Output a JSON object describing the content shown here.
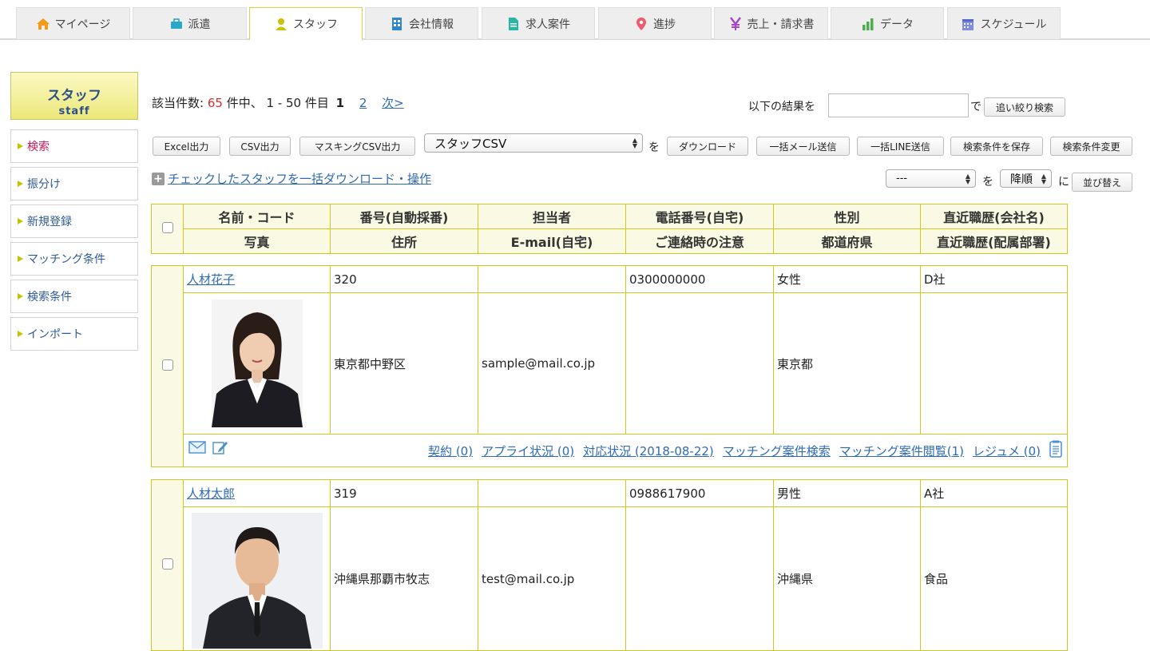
{
  "tabs": [
    {
      "label": "マイページ",
      "icon": "home-icon",
      "color": "#f29a1a"
    },
    {
      "label": "派遣",
      "icon": "briefcase-icon",
      "color": "#2aa7c9"
    },
    {
      "label": "スタッフ",
      "icon": "person-icon",
      "color": "#c9c200"
    },
    {
      "label": "会社情報",
      "icon": "building-icon",
      "color": "#2f87c9"
    },
    {
      "label": "求人案件",
      "icon": "document-icon",
      "color": "#27b5a8"
    },
    {
      "label": "進捗",
      "icon": "map-pin-icon",
      "color": "#ee5b6e"
    },
    {
      "label": "売上・請求書",
      "icon": "yen-icon",
      "color": "#a446c6"
    },
    {
      "label": "データ",
      "icon": "bar-chart-icon",
      "color": "#4cae4c"
    },
    {
      "label": "スケジュール",
      "icon": "calendar-icon",
      "color": "#7e8ee6"
    }
  ],
  "sidebar": {
    "title": "スタッフ",
    "subtitle": "staff",
    "items": [
      {
        "label": "検索"
      },
      {
        "label": "振分け"
      },
      {
        "label": "新規登録"
      },
      {
        "label": "マッチング条件"
      },
      {
        "label": "検索条件"
      },
      {
        "label": "インポート"
      }
    ]
  },
  "results": {
    "prefix": "該当件数:",
    "count": "65",
    "suffix": "件中、 1 - 50 件目",
    "current_page": "1",
    "page2": "2",
    "next": "次>"
  },
  "refine": {
    "label_before": "以下の結果を",
    "input_value": "",
    "label_after": "で",
    "button": "追い絞り検索"
  },
  "toolbar": {
    "excel": "Excel出力",
    "csv": "CSV出力",
    "masking_csv": "マスキングCSV出力",
    "csv_type_selected": "スタッフCSV",
    "wo": "を",
    "download": "ダウンロード",
    "bulk_mail": "一括メール送信",
    "bulk_line": "一括LINE送信",
    "save_search": "検索条件を保存",
    "change_search": "検索条件変更"
  },
  "bulk_link": "チェックしたスタッフを一括ダウンロード・操作",
  "sort": {
    "field_selected": "---",
    "wo": "を",
    "order_selected": "降順",
    "ni": "に",
    "button": "並び替え"
  },
  "header": {
    "row1": [
      "名前・コード",
      "番号(自動採番)",
      "担当者",
      "電話番号(自宅)",
      "性別",
      "直近職歴(会社名)"
    ],
    "row2": [
      "写真",
      "住所",
      "E-mail(自宅)",
      "ご連絡時の注意",
      "都道府県",
      "直近職歴(配属部署)"
    ]
  },
  "staff": [
    {
      "name": "人材花子",
      "number": "320",
      "manager": "",
      "phone": "0300000000",
      "gender": "女性",
      "company": "D社",
      "address": "東京都中野区",
      "email": "sample@mail.co.jp",
      "note": "",
      "prefecture": "東京都",
      "department": "",
      "links": [
        "契約 (0)",
        "アプライ状況 (0)",
        "対応状況 (2018-08-22)",
        "マッチング案件検索",
        "マッチング案件閲覧(1)",
        "レジュメ (0)"
      ]
    },
    {
      "name": "人材太郎",
      "number": "319",
      "manager": "",
      "phone": "0988617900",
      "gender": "男性",
      "company": "A社",
      "address": "沖縄県那覇市牧志",
      "email": "test@mail.co.jp",
      "note": "",
      "prefecture": "沖縄県",
      "department": "食品"
    }
  ]
}
